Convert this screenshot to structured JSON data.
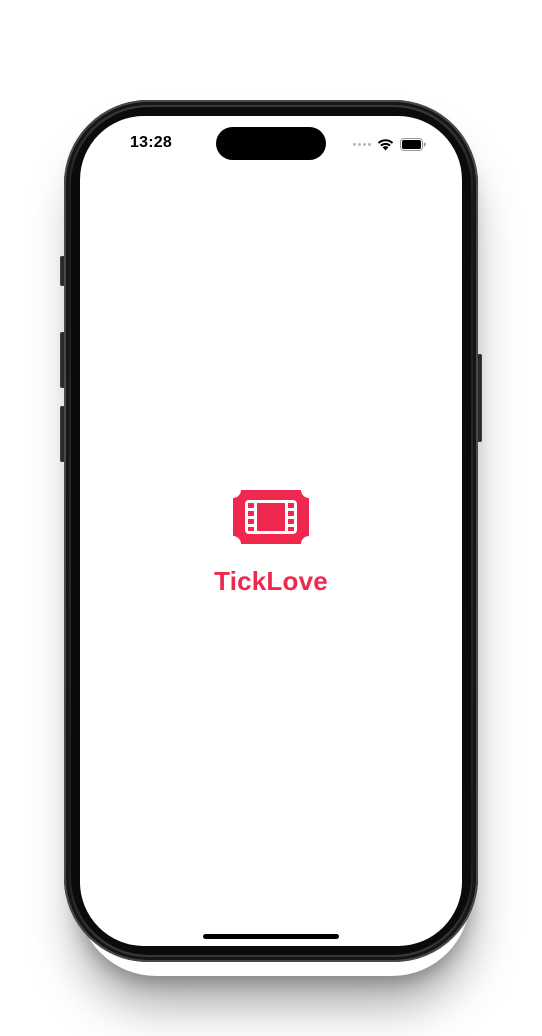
{
  "status_bar": {
    "time": "13:28",
    "icons": [
      "signal-dots-icon",
      "wifi-icon",
      "battery-icon"
    ]
  },
  "splash": {
    "logo_icon": "film-ticket-icon",
    "app_name": "TickLove"
  },
  "colors": {
    "brand": "#f0284f",
    "background": "#ffffff",
    "device_frame": "#1c1c1e"
  }
}
